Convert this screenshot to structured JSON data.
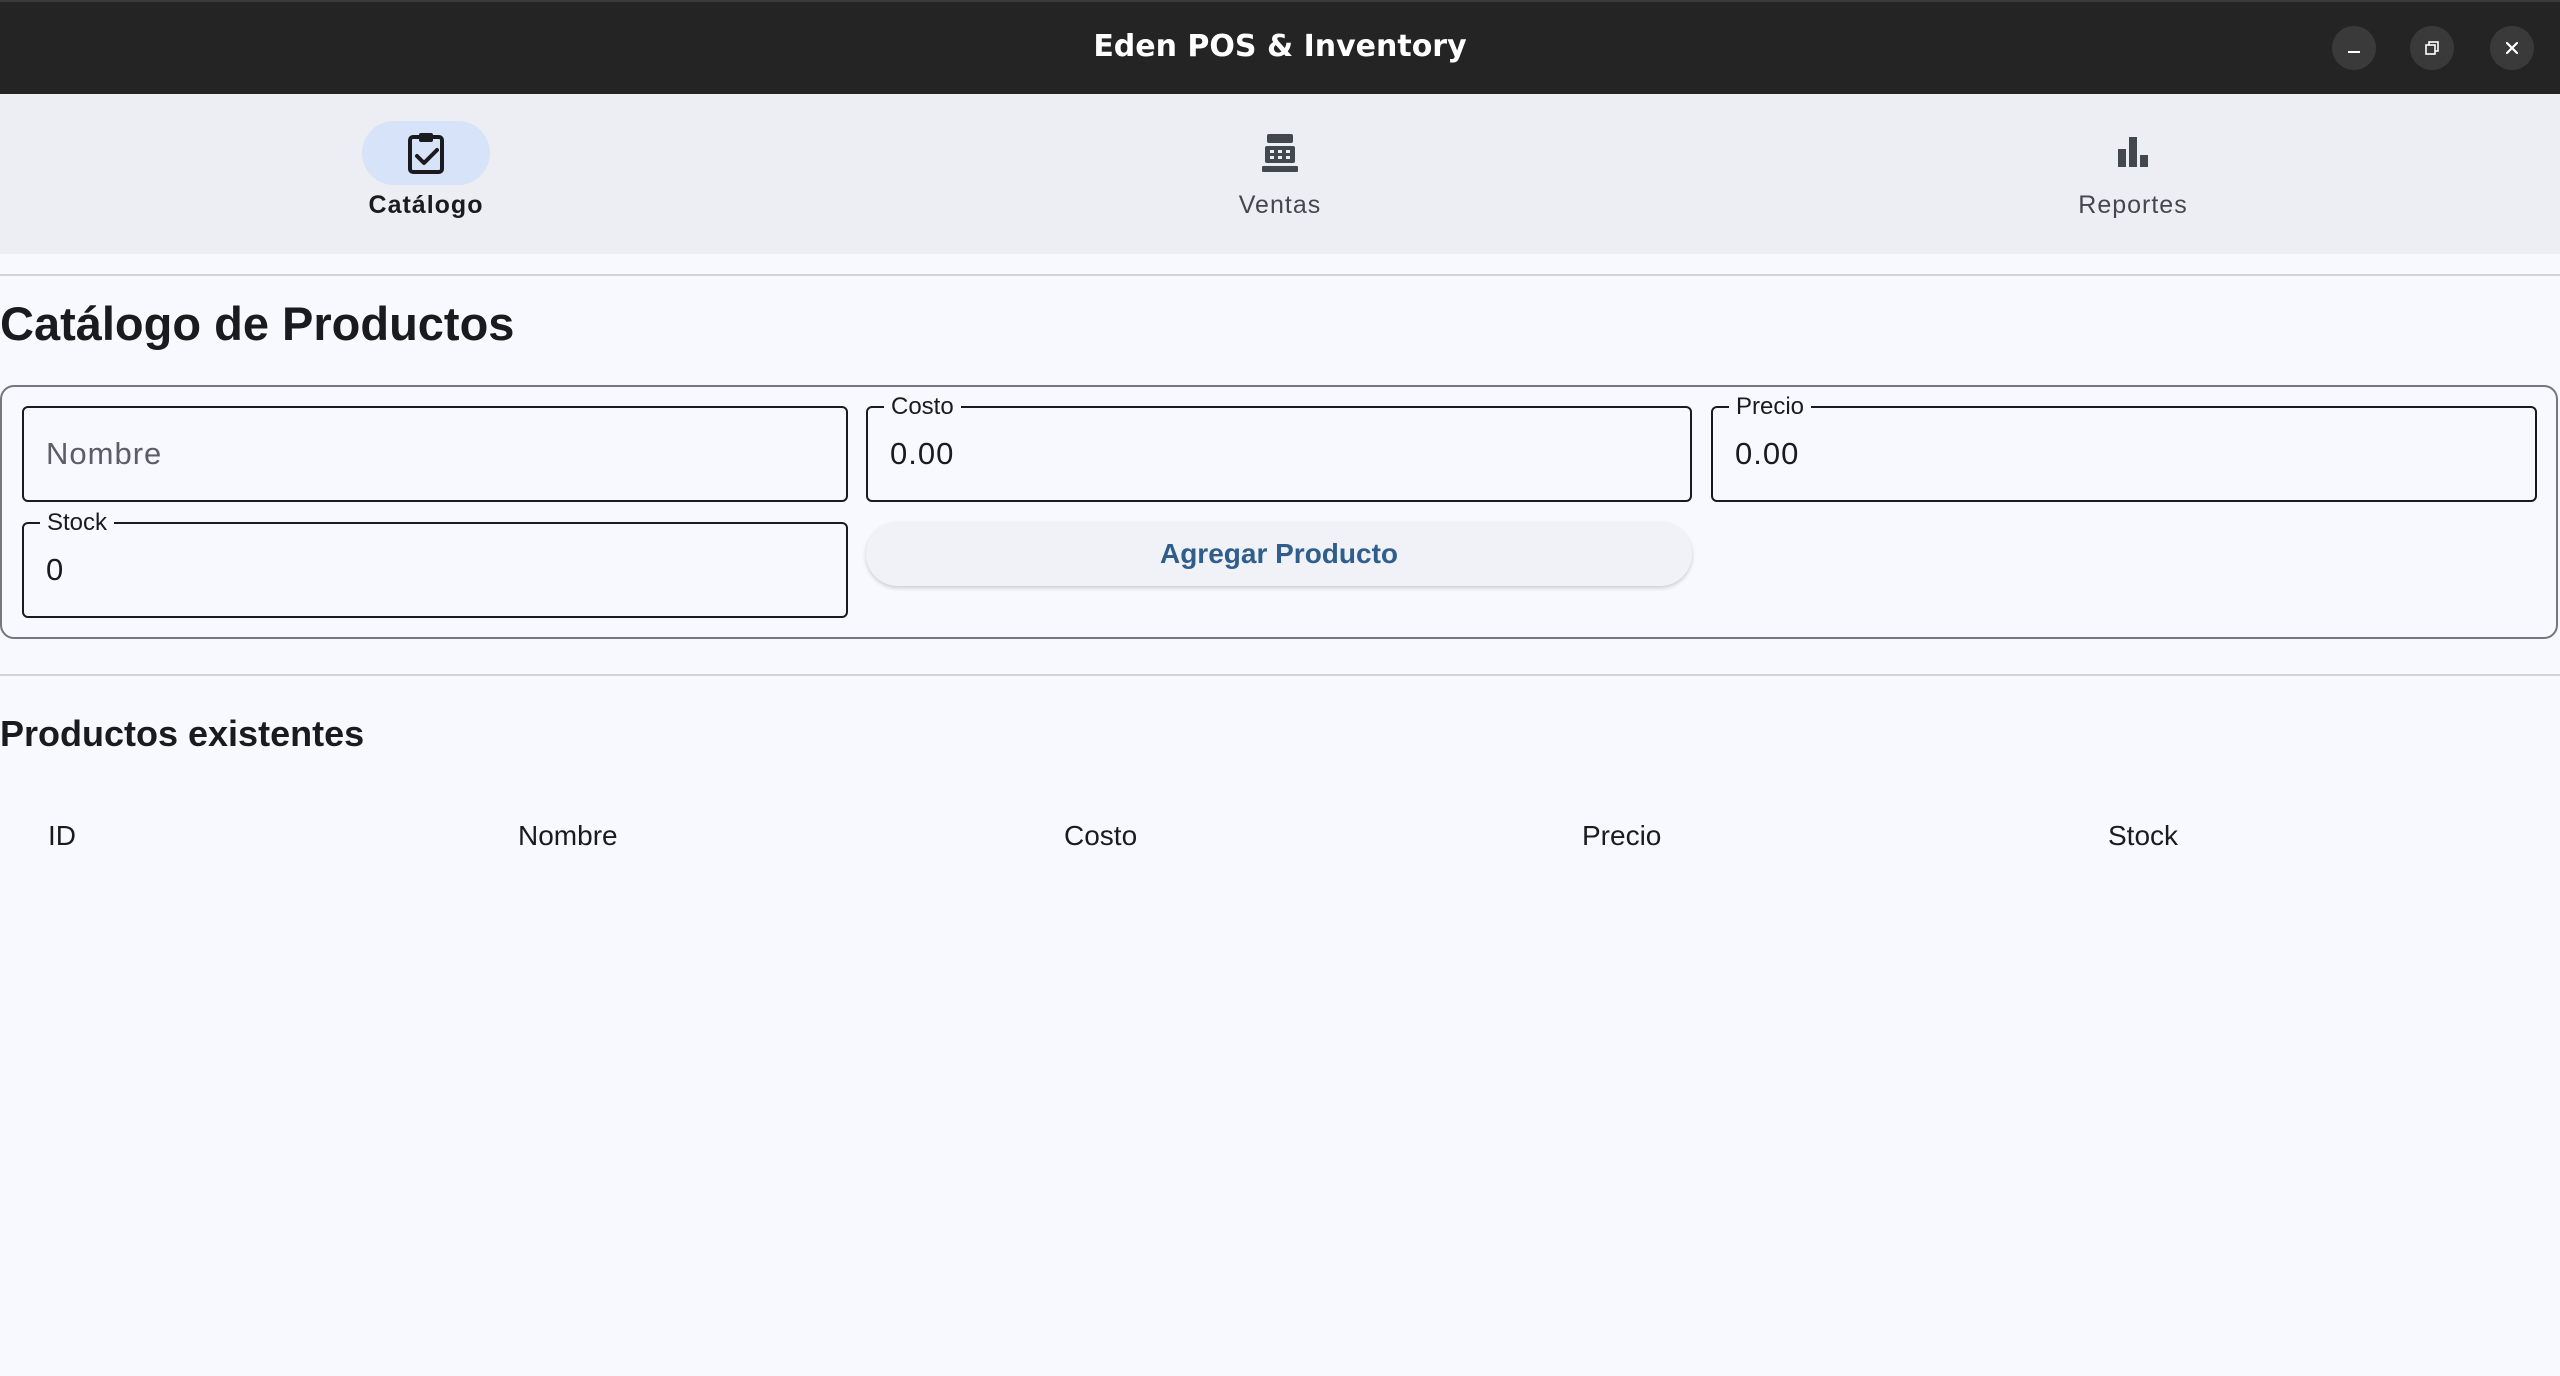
{
  "window": {
    "title": "Eden POS & Inventory",
    "controls": [
      "minimize",
      "maximize",
      "close"
    ]
  },
  "nav": {
    "items": [
      {
        "label": "Catálogo",
        "icon": "clipboard-check-icon",
        "active": true
      },
      {
        "label": "Ventas",
        "icon": "cash-register-icon",
        "active": false
      },
      {
        "label": "Reportes",
        "icon": "bar-chart-icon",
        "active": false
      }
    ]
  },
  "catalog": {
    "title": "Catálogo de Productos",
    "form": {
      "nombre": {
        "placeholder": "Nombre",
        "value": ""
      },
      "costo": {
        "label": "Costo",
        "value": "0.00"
      },
      "precio": {
        "label": "Precio",
        "value": "0.00"
      },
      "stock": {
        "label": "Stock",
        "value": "0"
      },
      "add_button": "Agregar Producto"
    }
  },
  "products": {
    "title": "Productos existentes",
    "columns": [
      "ID",
      "Nombre",
      "Costo",
      "Precio",
      "Stock"
    ],
    "rows": []
  },
  "colors": {
    "titlebar": "#242424",
    "nav_background": "#eceef4",
    "active_pill": "#d6e3f8",
    "page_background": "#f8f9ff",
    "button_text": "#2f5e8c"
  }
}
